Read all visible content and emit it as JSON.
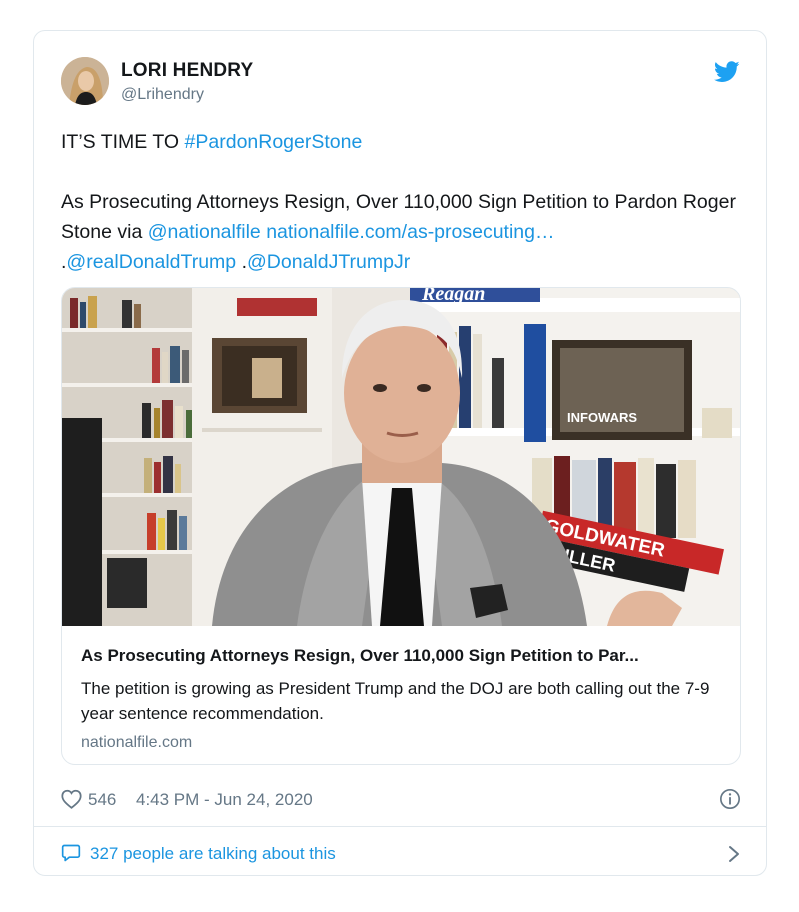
{
  "author": {
    "name": "LORI HENDRY",
    "handle": "@Lrihendry"
  },
  "tweet": {
    "line1_prefix": "IT’S TIME TO ",
    "hashtag": "#PardonRogerStone",
    "line2_text": "As Prosecuting Attorneys Resign, Over 110,000 Sign Petition to Pardon Roger Stone via ",
    "mention_nationalfile": "@nationalfile",
    "url_text": "nationalfile.com/as-prosecuting…",
    "line3_prefix": ".",
    "mention_trump": "@realDonaldTrump",
    "line3_sep": " .",
    "mention_trumpjr": "@DonaldJTrumpJr"
  },
  "media_text": {
    "reagan_book": "Reagan",
    "infowars_logo": "INFOWARS",
    "goldwater_book": "GOLDWATER",
    "miller_book": "MILLER"
  },
  "link_card": {
    "title": "As Prosecuting Attorneys Resign, Over 110,000 Sign Petition to Par...",
    "description": "The petition is growing as President Trump and the DOJ are both calling out the 7-9 year sentence recommendation.",
    "domain": "nationalfile.com"
  },
  "meta": {
    "likes": "546",
    "timestamp": "4:43 PM - Jun 24, 2020"
  },
  "footer": {
    "talking": "327 people are talking about this"
  },
  "colors": {
    "link": "#1b95e0",
    "secondary_text": "#657786",
    "border": "#e1e8ed",
    "twitter_blue": "#1da1f2"
  },
  "icons": [
    "twitter-bird-icon",
    "heart-icon",
    "info-icon",
    "speech-bubble-icon",
    "chevron-right-icon"
  ]
}
